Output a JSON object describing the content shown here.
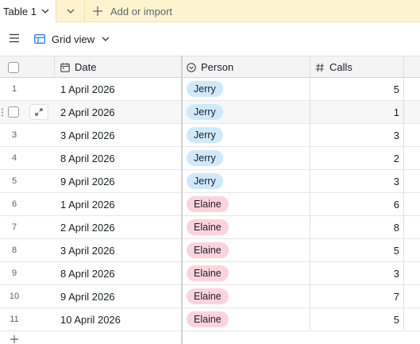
{
  "tabs": {
    "active_label": "Table 1",
    "add_import_label": "Add or import"
  },
  "view": {
    "name": "Grid view"
  },
  "columns": {
    "date": "Date",
    "person": "Person",
    "calls": "Calls"
  },
  "rows": [
    {
      "n": "1",
      "date": "1 April 2026",
      "person": "Jerry",
      "calls": "5"
    },
    {
      "n": "2",
      "date": "2 April 2026",
      "person": "Jerry",
      "calls": "1"
    },
    {
      "n": "3",
      "date": "3 April 2026",
      "person": "Jerry",
      "calls": "3"
    },
    {
      "n": "4",
      "date": "8 April 2026",
      "person": "Jerry",
      "calls": "2"
    },
    {
      "n": "5",
      "date": "9 April 2026",
      "person": "Jerry",
      "calls": "3"
    },
    {
      "n": "6",
      "date": "1 April 2026",
      "person": "Elaine",
      "calls": "6"
    },
    {
      "n": "7",
      "date": "2 April 2026",
      "person": "Elaine",
      "calls": "8"
    },
    {
      "n": "8",
      "date": "3 April 2026",
      "person": "Elaine",
      "calls": "5"
    },
    {
      "n": "9",
      "date": "8 April 2026",
      "person": "Elaine",
      "calls": "3"
    },
    {
      "n": "10",
      "date": "9 April 2026",
      "person": "Elaine",
      "calls": "7"
    },
    {
      "n": "11",
      "date": "10 April 2026",
      "person": "Elaine",
      "calls": "5"
    }
  ],
  "hovered_row": "2",
  "colors": {
    "tabbar_bg": "#fdf4cf",
    "jerry_pill": "#cfe9fb",
    "elaine_pill": "#fbd3df",
    "grid_view_icon": "#2d7ff9"
  },
  "icons": {
    "table_menu": "chevron-down-icon",
    "more_tables": "chevron-down-icon",
    "add": "plus-icon",
    "sidebar": "hamburger-menu-icon",
    "view": "grid-view-icon",
    "date_field": "calendar-icon",
    "person_field": "single-select-icon",
    "calls_field": "number-hash-icon",
    "expand_record": "expand-arrows-icon"
  }
}
